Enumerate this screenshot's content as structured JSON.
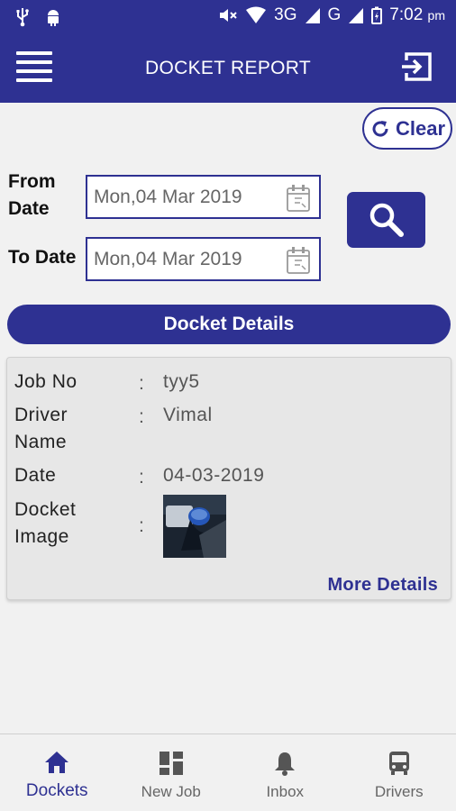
{
  "status_bar": {
    "network_3g": "3G",
    "network_g": "G",
    "time": "7:02",
    "ampm": "pm"
  },
  "app_bar": {
    "title": "DOCKET REPORT"
  },
  "filters": {
    "clear_label": "Clear",
    "from_label_line1": "From",
    "from_label_line2": "Date",
    "from_value": "Mon,04 Mar 2019",
    "to_label": "To Date",
    "to_value": "Mon,04 Mar 2019"
  },
  "section_title": "Docket Details",
  "docket": {
    "job_no_label": "Job No",
    "job_no_value": "tyy5",
    "driver_label_line1": "Driver",
    "driver_label_line2": "Name",
    "driver_value": "Vimal",
    "date_label": "Date",
    "date_value": "04-03-2019",
    "image_label_line1": "Docket",
    "image_label_line2": "Image",
    "separator": ":",
    "more_details": "More Details"
  },
  "bottom_nav": {
    "items": [
      {
        "label": "Dockets",
        "icon": "home-icon"
      },
      {
        "label": "New Job",
        "icon": "dashboard-icon"
      },
      {
        "label": "Inbox",
        "icon": "bell-icon"
      },
      {
        "label": "Drivers",
        "icon": "bus-icon"
      }
    ],
    "active_index": 0
  },
  "colors": {
    "primary": "#2e3192",
    "background": "#f1f1f1",
    "card": "#e7e7e7"
  }
}
